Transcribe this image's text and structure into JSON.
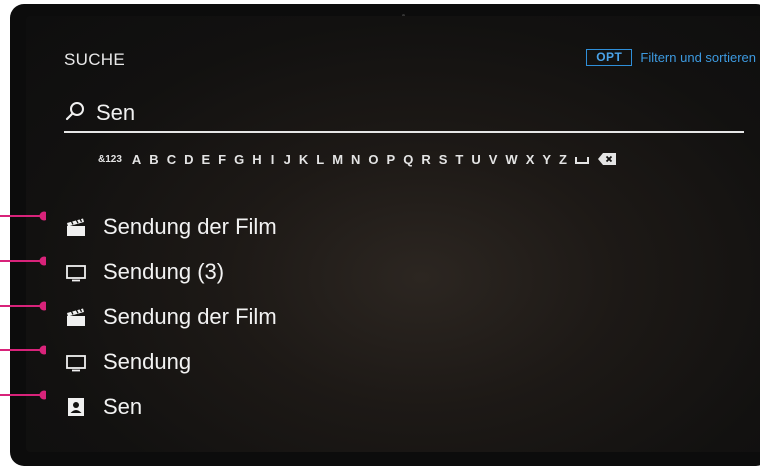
{
  "header": {
    "title": "SUCHE"
  },
  "options": {
    "key": "OPT",
    "label": "Filtern und sortieren"
  },
  "search": {
    "query": "Sen",
    "icon": "search-icon"
  },
  "keyboard": {
    "numbers_key": "&123",
    "letters": [
      "A",
      "B",
      "C",
      "D",
      "E",
      "F",
      "G",
      "H",
      "I",
      "J",
      "K",
      "L",
      "M",
      "N",
      "O",
      "P",
      "Q",
      "R",
      "S",
      "T",
      "U",
      "V",
      "W",
      "X",
      "Y",
      "Z"
    ],
    "space_icon": "space-icon",
    "backspace_icon": "backspace-icon"
  },
  "results": [
    {
      "type": "movie",
      "icon": "clapperboard-icon",
      "title": "Sendung der Film"
    },
    {
      "type": "tv",
      "icon": "tv-icon",
      "title": "Sendung (3)"
    },
    {
      "type": "movie",
      "icon": "clapperboard-icon",
      "title": "Sendung der Film"
    },
    {
      "type": "tv",
      "icon": "tv-icon",
      "title": "Sendung"
    },
    {
      "type": "person",
      "icon": "person-card-icon",
      "title": "Sen"
    }
  ],
  "colors": {
    "accent_blue": "#2f8fd9",
    "callout_magenta": "#d8237a",
    "text": "#f0f0f0",
    "background": "#121110"
  }
}
